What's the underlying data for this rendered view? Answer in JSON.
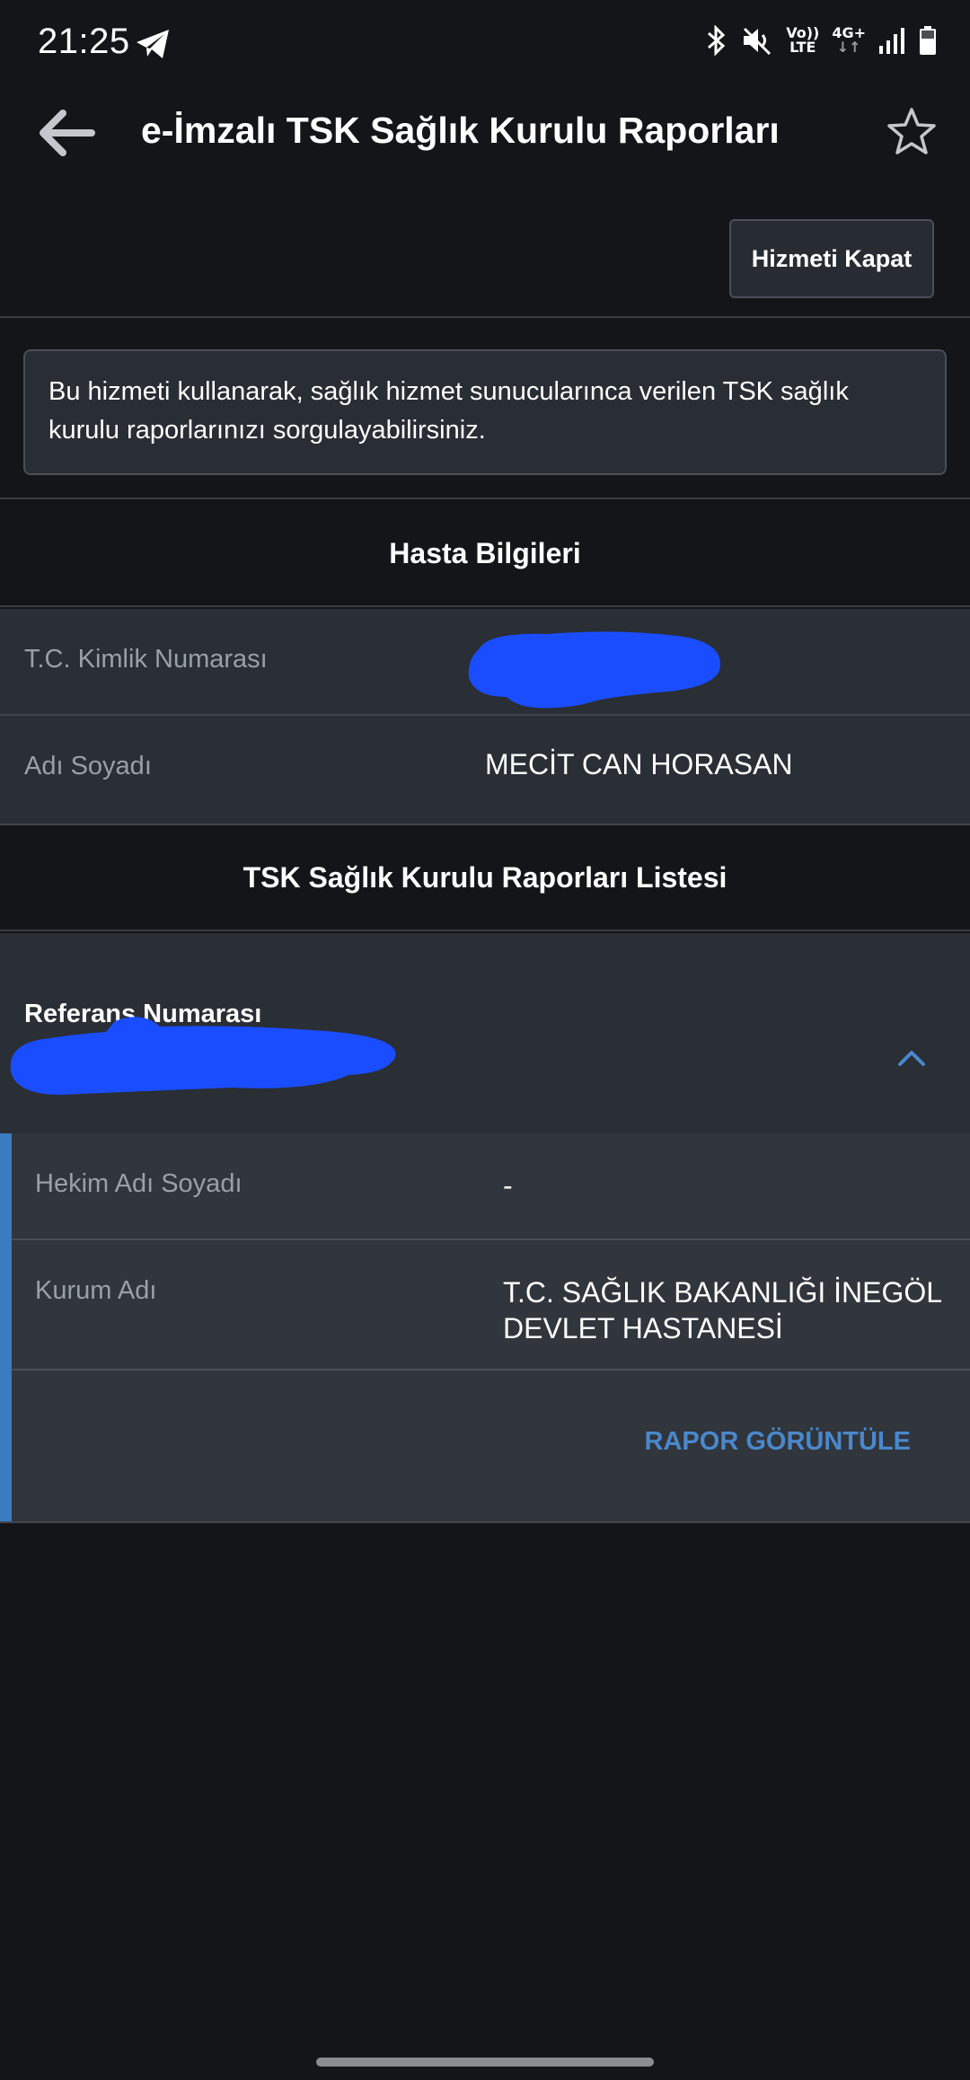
{
  "status_bar": {
    "time": "21:25",
    "lte_top": "Vo))",
    "lte_bottom": "LTE",
    "net_top": "4G+",
    "net_bottom": "↓↑"
  },
  "app_bar": {
    "title": "e-İmzalı TSK Sağlık Kurulu Raporları",
    "back_icon": "arrow-left-icon",
    "favorite_icon": "star-outline-icon"
  },
  "actions": {
    "close_service_label": "Hizmeti Kapat"
  },
  "info": {
    "text": "Bu hizmeti kullanarak, sağlık hizmet sunucularınca verilen TSK sağlık kurulu raporlarınızı sorgulayabilirsiniz."
  },
  "patient": {
    "header": "Hasta Bilgileri",
    "id_label": "T.C. Kimlik Numarası",
    "name_label": "Adı Soyadı",
    "name_value": "MECİT CAN HORASAN"
  },
  "reports": {
    "header": "TSK Sağlık Kurulu Raporları Listesi",
    "item": {
      "title": "Referans Numarası",
      "doctor_label": "Hekim Adı Soyadı",
      "doctor_value": "-",
      "institution_label": "Kurum Adı",
      "institution_value": "T.C. SAĞLIK BAKANLIĞI İNEGÖL DEVLET HASTANESİ",
      "view_label": "RAPOR GÖRÜNTÜLE"
    }
  },
  "colors": {
    "background": "#141518",
    "panel": "#2a2e35",
    "accent": "#3b7bbf",
    "link": "#4a88cc",
    "redaction": "#1a4dff"
  }
}
